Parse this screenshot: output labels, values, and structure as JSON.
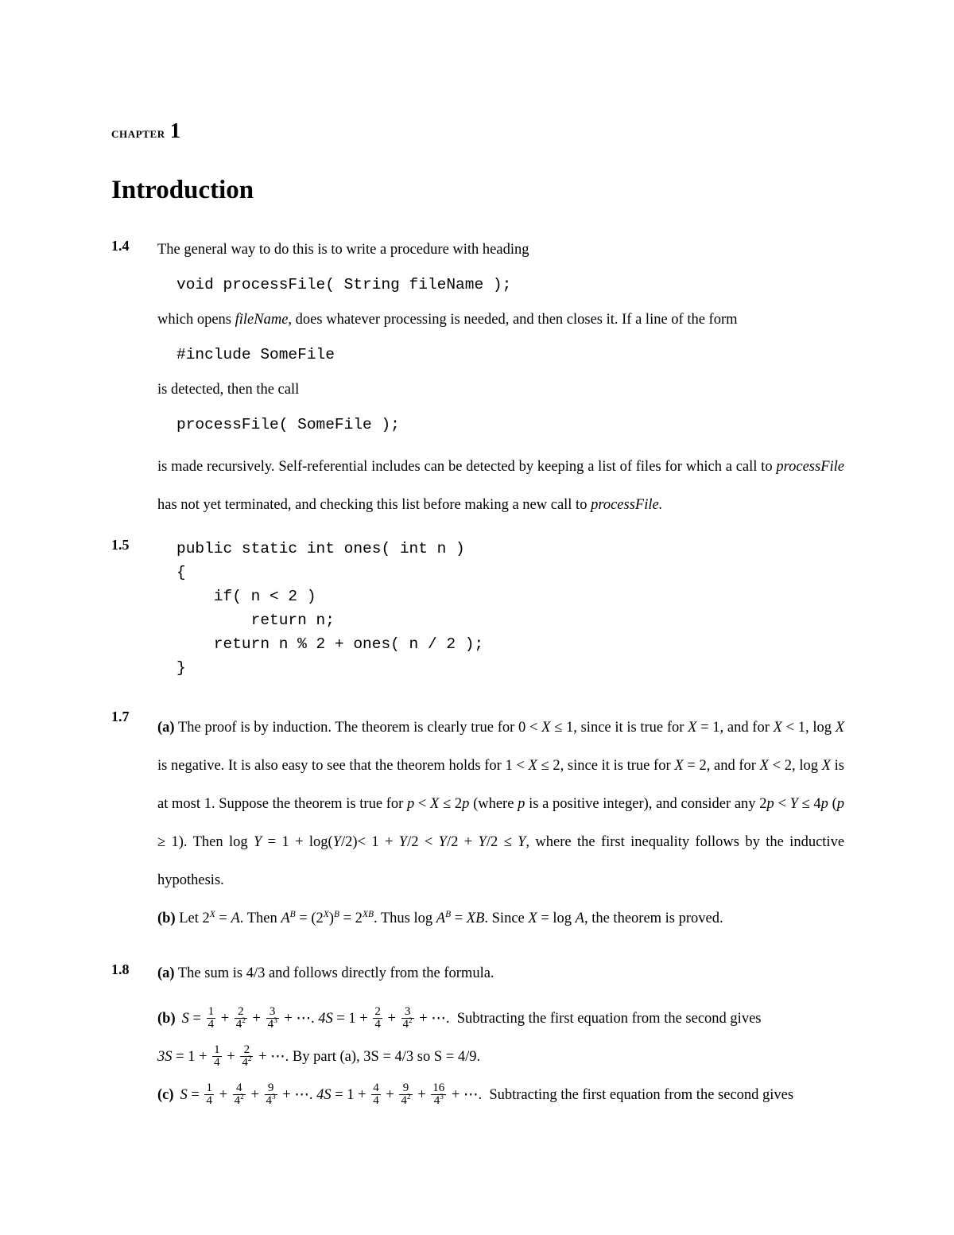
{
  "document": {
    "chapter_label": "Chapter",
    "chapter_number": "1",
    "title": "Introduction"
  },
  "exercises": [
    {
      "number": "1.4",
      "intro": "The general way to do this is to write a procedure with heading",
      "code_1": "void processFile( String fileName );",
      "text_2_pre": "which opens ",
      "text_2_italic": "fileName,",
      "text_2_post": " does whatever processing is needed, and then closes it. If a line of the form",
      "code_2": "#include SomeFile",
      "text_3": "is detected, then the call",
      "code_3": "processFile( SomeFile );",
      "text_4_a": "is made recursively. Self-referential includes can be detected by keeping a list of files for which a call to ",
      "text_4_italic_1": "processFile",
      "text_4_b": " has not yet terminated, and checking this list before making a new call to ",
      "text_4_italic_2": "processFile."
    },
    {
      "number": "1.5",
      "code": "public static int ones( int n )\n{\n    if( n < 2 )\n        return n;\n    return n % 2 + ones( n / 2 );\n}"
    },
    {
      "number": "1.7",
      "part_a_label": "(a)",
      "part_a_t1": "The proof is by induction. The theorem is clearly true for 0 < ",
      "part_a_x1": "X",
      "part_a_t2": " ≤ 1, since it is true for ",
      "part_a_x2": "X",
      "part_a_t3": " = 1, and for ",
      "part_a_x3": "X",
      "part_a_t4": " < 1, log ",
      "part_a_x4": "X",
      "part_a_t5": " is negative. It is also easy to see that the theorem holds for 1 < ",
      "part_a_x5": "X",
      "part_a_t6": " ≤ 2, since it is true for ",
      "part_a_x6": "X",
      "part_a_t7": " = 2, and for ",
      "part_a_x7": "X",
      "part_a_t8": " < 2, log ",
      "part_a_x8": "X",
      "part_a_t9": " is at most 1. Suppose the theorem is true for ",
      "part_a_p1": "p",
      "part_a_t10": " < ",
      "part_a_x9": "X",
      "part_a_t11": " ≤ 2",
      "part_a_p2": "p",
      "part_a_t12": " (where ",
      "part_a_p3": "p",
      "part_a_t13": " is a positive integer), and consider any 2",
      "part_a_p4": "p",
      "part_a_t14": " < ",
      "part_a_y1": "Y",
      "part_a_t15": " ≤ 4",
      "part_a_p5": "p",
      "part_a_t16": " (",
      "part_a_p6": "p",
      "part_a_t17": " ≥ 1). Then log ",
      "part_a_y2": "Y",
      "part_a_t18": " = 1 + log(",
      "part_a_y3": "Y",
      "part_a_t19": "/2)< 1 + ",
      "part_a_y4": "Y",
      "part_a_t20": "/2 < ",
      "part_a_y5": "Y",
      "part_a_t21": "/2 + ",
      "part_a_y6": "Y",
      "part_a_t22": "/2 ≤ ",
      "part_a_y7": "Y",
      "part_a_t23": ", where the first inequality follows by the inductive hypothesis.",
      "part_b_label": "(b)",
      "part_b_t1": "Let 2",
      "part_b_sup1": "X",
      "part_b_t2": " = ",
      "part_b_a1": "A",
      "part_b_t3": ". Then ",
      "part_b_a2": "A",
      "part_b_sup2": "B",
      "part_b_t4": " = (2",
      "part_b_sup3": "X",
      "part_b_t5": ")",
      "part_b_sup4": "B",
      "part_b_t6": " = 2",
      "part_b_sup5": "XB",
      "part_b_t7": ". Thus log ",
      "part_b_a3": "A",
      "part_b_sup6": "B",
      "part_b_t8": " = ",
      "part_b_xb": "XB",
      "part_b_t9": ". Since ",
      "part_b_x": "X",
      "part_b_t10": " = log ",
      "part_b_a4": "A",
      "part_b_t11": ", the theorem is proved."
    },
    {
      "number": "1.8",
      "part_a_label": "(a)",
      "part_a_text": "The sum is 4/3 and follows directly from the formula.",
      "part_b_label": "(b)",
      "part_b_tail": "Subtracting the first equation from the second gives",
      "part_b_eq2_tail": "By part (a), 3S = 4/3 so S = 4/9.",
      "part_c_label": "(c)",
      "part_c_tail": "Subtracting the first equation from the second gives"
    }
  ],
  "math_symbols": {
    "S": "S",
    "equals": "=",
    "plus": "+",
    "ellipsis": "⋯",
    "period": ".",
    "four": "4",
    "one": "1",
    "three": "3"
  },
  "formulas": {
    "b_eq1": {
      "lhs": "S",
      "terms": [
        {
          "num": "1",
          "den": "4",
          "den_sup": ""
        },
        {
          "num": "2",
          "den": "4",
          "den_sup": "2"
        },
        {
          "num": "3",
          "den": "4",
          "den_sup": "3"
        }
      ]
    },
    "b_eq2": {
      "lhs": "4S",
      "first": "1",
      "terms": [
        {
          "num": "2",
          "den": "4",
          "den_sup": ""
        },
        {
          "num": "3",
          "den": "4",
          "den_sup": "2"
        }
      ]
    },
    "b_eq3": {
      "lhs": "3S",
      "first": "1",
      "terms": [
        {
          "num": "1",
          "den": "4",
          "den_sup": ""
        },
        {
          "num": "2",
          "den": "4",
          "den_sup": "2"
        }
      ]
    },
    "c_eq1": {
      "lhs": "S",
      "terms": [
        {
          "num": "1",
          "den": "4",
          "den_sup": ""
        },
        {
          "num": "4",
          "den": "4",
          "den_sup": "2"
        },
        {
          "num": "9",
          "den": "4",
          "den_sup": "3"
        }
      ]
    },
    "c_eq2": {
      "lhs": "4S",
      "first": "1",
      "terms": [
        {
          "num": "4",
          "den": "4",
          "den_sup": ""
        },
        {
          "num": "9",
          "den": "4",
          "den_sup": "2"
        },
        {
          "num": "16",
          "den": "4",
          "den_sup": "3"
        }
      ]
    }
  },
  "colors": {
    "page_background": "#ffffff",
    "text": "#000000"
  }
}
